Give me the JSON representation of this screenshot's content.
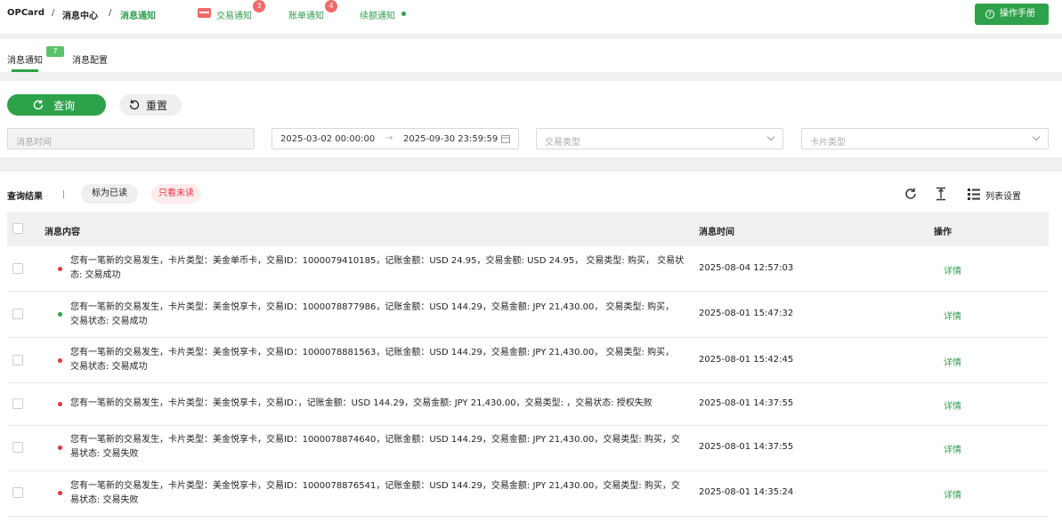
{
  "breadcrumb": [
    "OPCard",
    "消息中心",
    "消息通知"
  ],
  "notify_tabs": [
    {
      "label": "交易通知",
      "badge": "3"
    },
    {
      "label": "账单通知",
      "badge": "4"
    },
    {
      "label": "续额通知"
    }
  ],
  "manual_button": "操作手册",
  "tabs": [
    {
      "label": "消息通知",
      "badge": "7",
      "active": true
    },
    {
      "label": "消息配置"
    }
  ],
  "filters": {
    "query_label": "查询",
    "reset_label": "重置",
    "time_placeholder": "消息时间",
    "range_start": "2025-03-02 00:00:00",
    "range_end": "2025-09-30 23:59:59",
    "trade_type_placeholder": "交易类型",
    "card_type_placeholder": "卡片类型"
  },
  "results": {
    "title": "查询结果",
    "mark_read": "标为已读",
    "unread_only": "只看未读",
    "column_settings": "列表设置",
    "columns": {
      "content": "消息内容",
      "time": "消息时间",
      "action": "操作"
    },
    "rows": [
      {
        "status": "red",
        "content": "您有一笔新的交易发生，卡片类型：美金单币卡，交易ID：1000079410185，记账金额：USD 24.95，交易金额: USD 24.95， 交易类型: 购买， 交易状态: 交易成功",
        "time": "2025-08-04 12:57:03",
        "action": "详情"
      },
      {
        "status": "green",
        "content": "您有一笔新的交易发生，卡片类型：美金悦享卡，交易ID：1000078877986，记账金额：USD 144.29，交易金额: JPY 21,430.00， 交易类型: 购买， 交易状态: 交易成功",
        "time": "2025-08-01 15:47:32",
        "action": "详情"
      },
      {
        "status": "red",
        "content": "您有一笔新的交易发生，卡片类型：美金悦享卡，交易ID：1000078881563，记账金额：USD 144.29，交易金额: JPY 21,430.00， 交易类型: 购买， 交易状态: 交易成功",
        "time": "2025-08-01 15:42:45",
        "action": "详情"
      },
      {
        "status": "red",
        "content": "您有一笔新的交易发生，卡片类型：美金悦享卡，交易ID：，记账金额：USD 144.29，交易金额: JPY 21,430.00，交易类型: ，交易状态: 授权失败",
        "time": "2025-08-01 14:37:55",
        "action": "详情"
      },
      {
        "status": "red",
        "content": "您有一笔新的交易发生，卡片类型：美金悦享卡，交易ID：1000078874640，记账金额：USD 144.29，交易金额: JPY 21,430.00，交易类型: 购买，交易状态: 交易失败",
        "time": "2025-08-01 14:37:55",
        "action": "详情"
      },
      {
        "status": "red",
        "content": "您有一笔新的交易发生，卡片类型：美金悦享卡，交易ID：1000078876541，记账金额：USD 144.29，交易金额: JPY 21,430.00，交易类型: 购买，交易状态: 交易失败",
        "time": "2025-08-01 14:35:24",
        "action": "详情"
      }
    ]
  },
  "colors": {
    "accent": "#2ea24a",
    "unread_dot": "#e8323c",
    "read_dot": "#2ea24a",
    "badge": "#f06a6a"
  }
}
